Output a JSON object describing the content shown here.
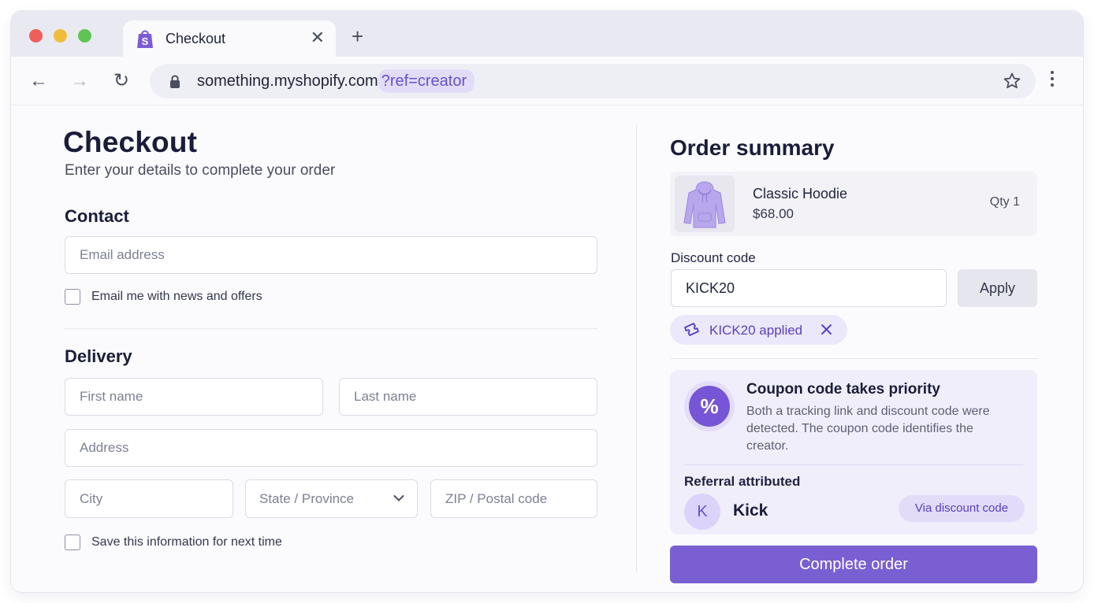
{
  "browser": {
    "tab_title": "Checkout",
    "new_tab_symbol": "+",
    "url_host": "something.myshopify.com",
    "url_query": "?ref=creator"
  },
  "checkout": {
    "title": "Checkout",
    "subtitle": "Enter your details to complete your order",
    "contact": {
      "title": "Contact",
      "email_placeholder": "Email address",
      "news_checkbox_label": "Email me with news and offers"
    },
    "delivery": {
      "title": "Delivery",
      "first_name_placeholder": "First name",
      "last_name_placeholder": "Last name",
      "address_placeholder": "Address",
      "city_placeholder": "City",
      "state_label": "State / Province",
      "zip_placeholder": "ZIP / Postal code",
      "save_checkbox_label": "Save this information for next time"
    }
  },
  "summary": {
    "title": "Order summary",
    "item": {
      "name": "Classic Hoodie",
      "price": "$68.00",
      "qty": "Qty 1"
    },
    "discount": {
      "label": "Discount code",
      "value": "KICK20",
      "apply_label": "Apply",
      "applied_text": "KICK20 applied"
    },
    "attribution": {
      "priority_title": "Coupon code takes priority",
      "priority_body": "Both a tracking link and discount code were detected. The coupon code identifies the creator.",
      "percent_symbol": "%",
      "referral_title": "Referral attributed",
      "avatar_initial": "K",
      "creator_name": "Kick",
      "via_label": "Via discount code"
    },
    "complete_label": "Complete order"
  },
  "colors": {
    "accent": "#7a5fd2",
    "accent_dark": "#5a3fc4",
    "accent_light": "#ece8fb"
  }
}
